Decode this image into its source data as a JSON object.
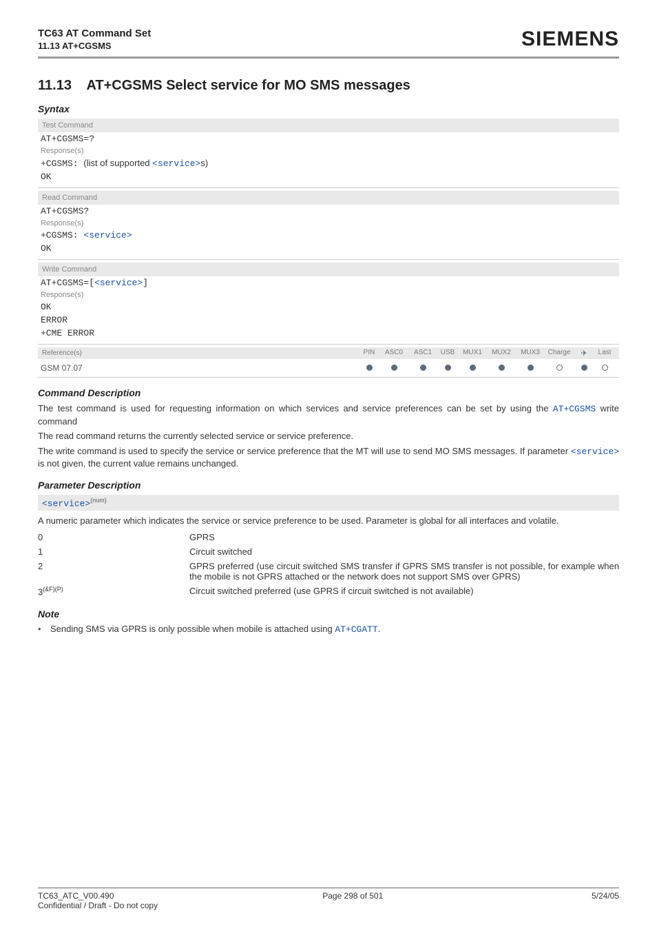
{
  "header": {
    "title_line1": "TC63 AT Command Set",
    "title_line2": "11.13 AT+CGSMS",
    "logo": "SIEMENS"
  },
  "section": {
    "number": "11.13",
    "title": "AT+CGSMS   Select service for MO SMS messages"
  },
  "syntax": {
    "heading": "Syntax",
    "test_command": {
      "label": "Test Command",
      "cmd": "AT+CGSMS=?",
      "response_label": "Response(s)",
      "resp_prefix": "+CGSMS: ",
      "resp_mid1": "(list of supported ",
      "resp_link": "<service>",
      "resp_mid2": "s)",
      "ok": "OK"
    },
    "read_command": {
      "label": "Read Command",
      "cmd": "AT+CGSMS?",
      "response_label": "Response(s)",
      "resp_prefix": "+CGSMS: ",
      "resp_link": "<service>",
      "ok": "OK"
    },
    "write_command": {
      "label": "Write Command",
      "cmd_prefix": "AT+CGSMS=[",
      "cmd_link": "<service>",
      "cmd_suffix": "]",
      "response_label": "Response(s)",
      "ok": "OK",
      "error": "ERROR",
      "cme": "+CME ERROR"
    },
    "reference": {
      "label": "Reference(s)",
      "cols": [
        "PIN",
        "ASC0",
        "ASC1",
        "USB",
        "MUX1",
        "MUX2",
        "MUX3",
        "Charge",
        "✈",
        "Last"
      ],
      "value_label": "GSM 07.07",
      "values": [
        "filled",
        "filled",
        "filled",
        "filled",
        "filled",
        "filled",
        "filled",
        "empty",
        "filled",
        "empty"
      ]
    }
  },
  "cmd_desc": {
    "heading": "Command Description",
    "p1a": "The test command is used for requesting information on which services and service preferences can be set by using the ",
    "p1link": "AT+CGSMS",
    "p1b": " write command",
    "p2": "The read command returns the currently selected service or service preference.",
    "p3a": "The write command is used to specify the service or service preference that the MT will use to send MO SMS messages. If parameter ",
    "p3link": "<service>",
    "p3b": " is not given, the current value remains unchanged."
  },
  "param_desc": {
    "heading": "Parameter Description",
    "param_name": "<service>",
    "param_sup": "(num)",
    "intro": "A numeric parameter which indicates the service or service preference to be used. Parameter is global for all interfaces and volatile.",
    "rows": [
      {
        "k": "0",
        "v": "GPRS"
      },
      {
        "k": "1",
        "v": "Circuit switched"
      },
      {
        "k": "2",
        "v": "GPRS preferred (use circuit switched SMS transfer if GPRS SMS transfer is not possible, for example when the mobile is not GPRS attached or the network does not support SMS over GPRS)"
      },
      {
        "k": "3",
        "ksup": "(&F)(P)",
        "v": "Circuit switched preferred (use GPRS if circuit switched is not available)"
      }
    ]
  },
  "note": {
    "heading": "Note",
    "bullet_a": "Sending SMS via GPRS is only possible when mobile is attached using ",
    "bullet_link": "AT+CGATT",
    "bullet_b": "."
  },
  "footer": {
    "left1": "TC63_ATC_V00.490",
    "center": "Page 298 of 501",
    "right": "5/24/05",
    "left2": "Confidential / Draft - Do not copy"
  }
}
